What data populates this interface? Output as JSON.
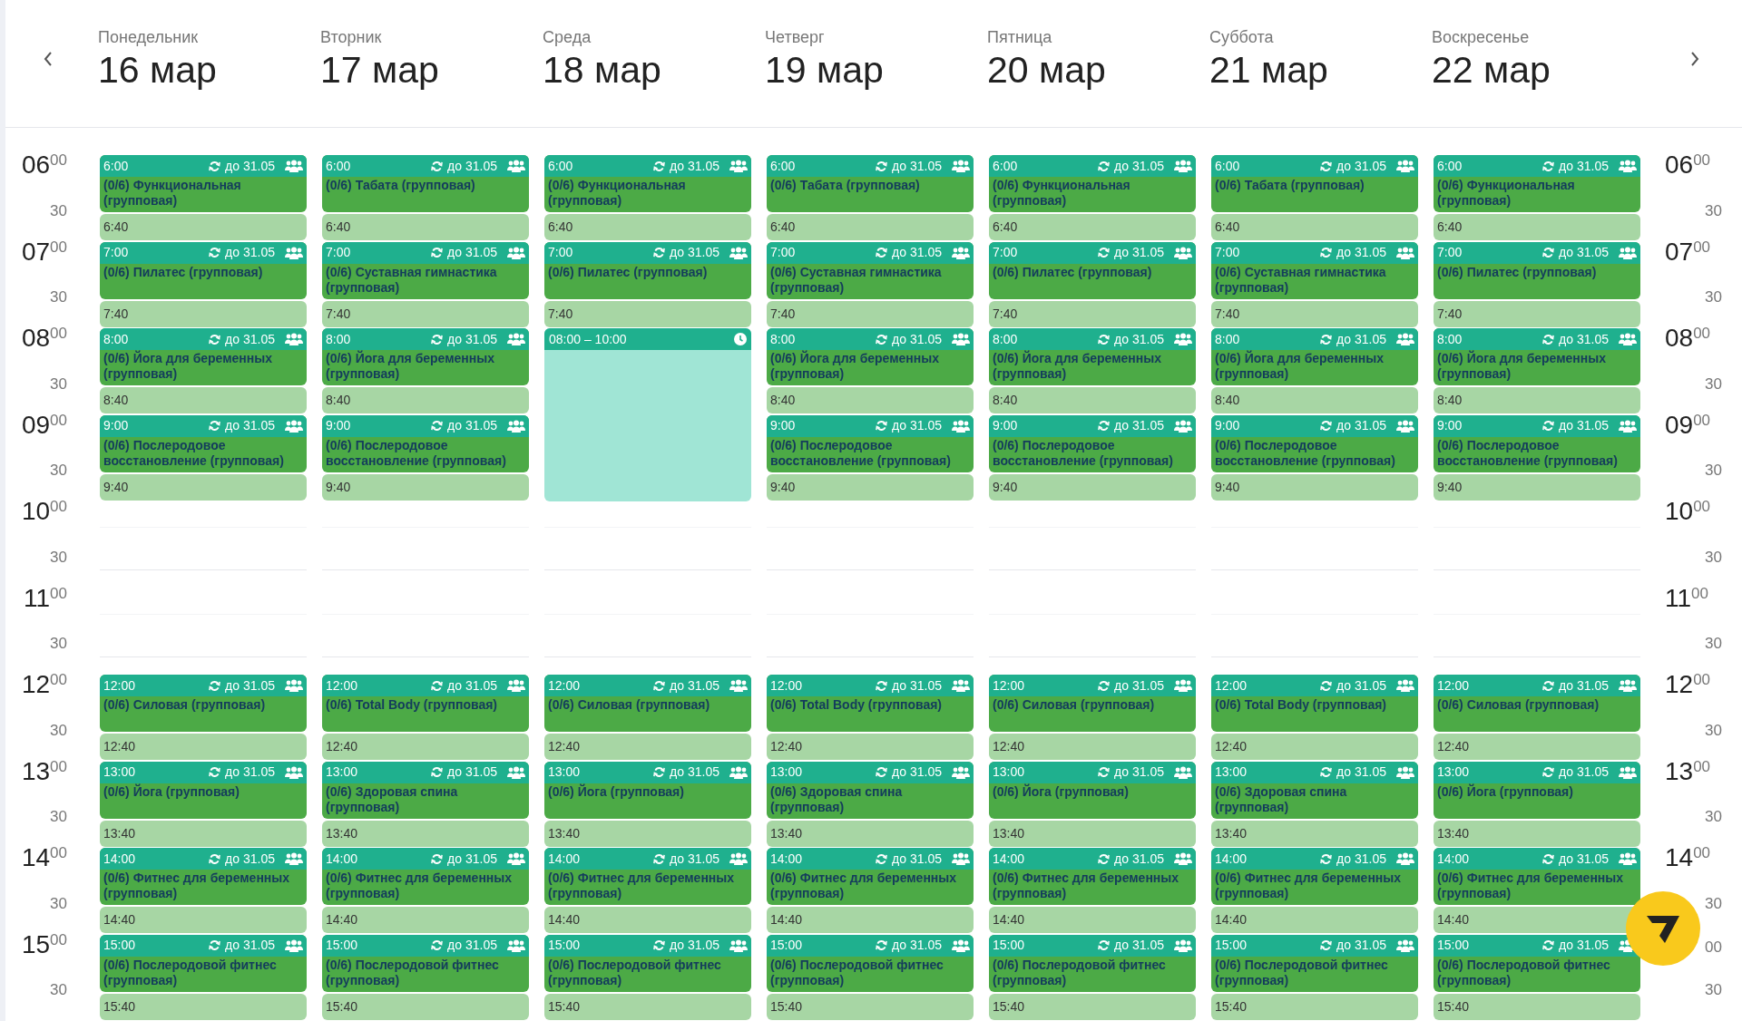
{
  "days": [
    {
      "weekday": "Понедельник",
      "date": "16 мар",
      "slots": [
        {
          "kind": "class",
          "start": "6:00",
          "repeat": "до 31.05",
          "title": "(0/6) Функциональная (групповая)",
          "end": "6:40"
        },
        {
          "kind": "class",
          "start": "7:00",
          "repeat": "до 31.05",
          "title": "(0/6) Пилатес (групповая)",
          "end": "7:40"
        },
        {
          "kind": "class",
          "start": "8:00",
          "repeat": "до 31.05",
          "title": "(0/6) Йога для беременных (групповая)",
          "end": "8:40"
        },
        {
          "kind": "class",
          "start": "9:00",
          "repeat": "до 31.05",
          "title": "(0/6) Послеродовое восстановление (групповая)",
          "end": "9:40"
        },
        {
          "kind": "free"
        },
        {
          "kind": "free"
        },
        {
          "kind": "class",
          "start": "12:00",
          "repeat": "до 31.05",
          "title": "(0/6) Силовая (групповая)",
          "end": "12:40"
        },
        {
          "kind": "class",
          "start": "13:00",
          "repeat": "до 31.05",
          "title": "(0/6) Йога (групповая)",
          "end": "13:40"
        },
        {
          "kind": "class",
          "start": "14:00",
          "repeat": "до 31.05",
          "title": "(0/6) Фитнес для беременных (групповая)",
          "end": "14:40"
        },
        {
          "kind": "class",
          "start": "15:00",
          "repeat": "до 31.05",
          "title": "(0/6) Послеродовой фитнес (групповая)",
          "end": "15:40"
        }
      ]
    },
    {
      "weekday": "Вторник",
      "date": "17 мар",
      "slots": [
        {
          "kind": "class",
          "start": "6:00",
          "repeat": "до 31.05",
          "title": "(0/6) Табата (групповая)",
          "end": "6:40"
        },
        {
          "kind": "class",
          "start": "7:00",
          "repeat": "до 31.05",
          "title": "(0/6) Суставная гимнастика (групповая)",
          "end": "7:40"
        },
        {
          "kind": "class",
          "start": "8:00",
          "repeat": "до 31.05",
          "title": "(0/6) Йога для беременных (групповая)",
          "end": "8:40"
        },
        {
          "kind": "class",
          "start": "9:00",
          "repeat": "до 31.05",
          "title": "(0/6) Послеродовое восстановление (групповая)",
          "end": "9:40"
        },
        {
          "kind": "free"
        },
        {
          "kind": "free"
        },
        {
          "kind": "class",
          "start": "12:00",
          "repeat": "до 31.05",
          "title": "(0/6) Total Body (групповая)",
          "end": "12:40"
        },
        {
          "kind": "class",
          "start": "13:00",
          "repeat": "до 31.05",
          "title": "(0/6) Здоровая спина (групповая)",
          "end": "13:40"
        },
        {
          "kind": "class",
          "start": "14:00",
          "repeat": "до 31.05",
          "title": "(0/6) Фитнес для беременных (групповая)",
          "end": "14:40"
        },
        {
          "kind": "class",
          "start": "15:00",
          "repeat": "до 31.05",
          "title": "(0/6) Послеродовой фитнес (групповая)",
          "end": "15:40"
        }
      ]
    },
    {
      "weekday": "Среда",
      "date": "18 мар",
      "slots": [
        {
          "kind": "class",
          "start": "6:00",
          "repeat": "до 31.05",
          "title": "(0/6) Функциональная (групповая)",
          "end": "6:40"
        },
        {
          "kind": "class",
          "start": "7:00",
          "repeat": "до 31.05",
          "title": "(0/6) Пилатес (групповая)",
          "end": "7:40"
        },
        {
          "kind": "booking",
          "label": "08:00 – 10:00"
        },
        {
          "kind": "free"
        },
        {
          "kind": "free"
        },
        {
          "kind": "class",
          "start": "12:00",
          "repeat": "до 31.05",
          "title": "(0/6) Силовая (групповая)",
          "end": "12:40"
        },
        {
          "kind": "class",
          "start": "13:00",
          "repeat": "до 31.05",
          "title": "(0/6) Йога (групповая)",
          "end": "13:40"
        },
        {
          "kind": "class",
          "start": "14:00",
          "repeat": "до 31.05",
          "title": "(0/6) Фитнес для беременных (групповая)",
          "end": "14:40"
        },
        {
          "kind": "class",
          "start": "15:00",
          "repeat": "до 31.05",
          "title": "(0/6) Послеродовой фитнес (групповая)",
          "end": "15:40"
        }
      ]
    },
    {
      "weekday": "Четверг",
      "date": "19 мар",
      "slots": [
        {
          "kind": "class",
          "start": "6:00",
          "repeat": "до 31.05",
          "title": "(0/6) Табата (групповая)",
          "end": "6:40"
        },
        {
          "kind": "class",
          "start": "7:00",
          "repeat": "до 31.05",
          "title": "(0/6) Суставная гимнастика (групповая)",
          "end": "7:40"
        },
        {
          "kind": "class",
          "start": "8:00",
          "repeat": "до 31.05",
          "title": "(0/6) Йога для беременных (групповая)",
          "end": "8:40"
        },
        {
          "kind": "class",
          "start": "9:00",
          "repeat": "до 31.05",
          "title": "(0/6) Послеродовое восстановление (групповая)",
          "end": "9:40"
        },
        {
          "kind": "free"
        },
        {
          "kind": "free"
        },
        {
          "kind": "class",
          "start": "12:00",
          "repeat": "до 31.05",
          "title": "(0/6) Total Body (групповая)",
          "end": "12:40"
        },
        {
          "kind": "class",
          "start": "13:00",
          "repeat": "до 31.05",
          "title": "(0/6) Здоровая спина (групповая)",
          "end": "13:40"
        },
        {
          "kind": "class",
          "start": "14:00",
          "repeat": "до 31.05",
          "title": "(0/6) Фитнес для беременных (групповая)",
          "end": "14:40"
        },
        {
          "kind": "class",
          "start": "15:00",
          "repeat": "до 31.05",
          "title": "(0/6) Послеродовой фитнес (групповая)",
          "end": "15:40"
        }
      ]
    },
    {
      "weekday": "Пятница",
      "date": "20 мар",
      "slots": [
        {
          "kind": "class",
          "start": "6:00",
          "repeat": "до 31.05",
          "title": "(0/6) Функциональная (групповая)",
          "end": "6:40"
        },
        {
          "kind": "class",
          "start": "7:00",
          "repeat": "до 31.05",
          "title": "(0/6) Пилатес (групповая)",
          "end": "7:40"
        },
        {
          "kind": "class",
          "start": "8:00",
          "repeat": "до 31.05",
          "title": "(0/6) Йога для беременных (групповая)",
          "end": "8:40"
        },
        {
          "kind": "class",
          "start": "9:00",
          "repeat": "до 31.05",
          "title": "(0/6) Послеродовое восстановление (групповая)",
          "end": "9:40"
        },
        {
          "kind": "free"
        },
        {
          "kind": "free"
        },
        {
          "kind": "class",
          "start": "12:00",
          "repeat": "до 31.05",
          "title": "(0/6) Силовая (групповая)",
          "end": "12:40"
        },
        {
          "kind": "class",
          "start": "13:00",
          "repeat": "до 31.05",
          "title": "(0/6) Йога (групповая)",
          "end": "13:40"
        },
        {
          "kind": "class",
          "start": "14:00",
          "repeat": "до 31.05",
          "title": "(0/6) Фитнес для беременных (групповая)",
          "end": "14:40"
        },
        {
          "kind": "class",
          "start": "15:00",
          "repeat": "до 31.05",
          "title": "(0/6) Послеродовой фитнес (групповая)",
          "end": "15:40"
        }
      ]
    },
    {
      "weekday": "Суббота",
      "date": "21 мар",
      "slots": [
        {
          "kind": "class",
          "start": "6:00",
          "repeat": "до 31.05",
          "title": "(0/6) Табата (групповая)",
          "end": "6:40"
        },
        {
          "kind": "class",
          "start": "7:00",
          "repeat": "до 31.05",
          "title": "(0/6) Суставная гимнастика (групповая)",
          "end": "7:40"
        },
        {
          "kind": "class",
          "start": "8:00",
          "repeat": "до 31.05",
          "title": "(0/6) Йога для беременных (групповая)",
          "end": "8:40"
        },
        {
          "kind": "class",
          "start": "9:00",
          "repeat": "до 31.05",
          "title": "(0/6) Послеродовое восстановление (групповая)",
          "end": "9:40"
        },
        {
          "kind": "free"
        },
        {
          "kind": "free"
        },
        {
          "kind": "class",
          "start": "12:00",
          "repeat": "до 31.05",
          "title": "(0/6) Total Body (групповая)",
          "end": "12:40"
        },
        {
          "kind": "class",
          "start": "13:00",
          "repeat": "до 31.05",
          "title": "(0/6) Здоровая спина (групповая)",
          "end": "13:40"
        },
        {
          "kind": "class",
          "start": "14:00",
          "repeat": "до 31.05",
          "title": "(0/6) Фитнес для беременных (групповая)",
          "end": "14:40"
        },
        {
          "kind": "class",
          "start": "15:00",
          "repeat": "до 31.05",
          "title": "(0/6) Послеродовой фитнес (групповая)",
          "end": "15:40"
        }
      ]
    },
    {
      "weekday": "Воскресенье",
      "date": "22 мар",
      "slots": [
        {
          "kind": "class",
          "start": "6:00",
          "repeat": "до 31.05",
          "title": "(0/6) Функциональная (групповая)",
          "end": "6:40"
        },
        {
          "kind": "class",
          "start": "7:00",
          "repeat": "до 31.05",
          "title": "(0/6) Пилатес (групповая)",
          "end": "7:40"
        },
        {
          "kind": "class",
          "start": "8:00",
          "repeat": "до 31.05",
          "title": "(0/6) Йога для беременных (групповая)",
          "end": "8:40"
        },
        {
          "kind": "class",
          "start": "9:00",
          "repeat": "до 31.05",
          "title": "(0/6) Послеродовое восстановление (групповая)",
          "end": "9:40"
        },
        {
          "kind": "free"
        },
        {
          "kind": "free"
        },
        {
          "kind": "class",
          "start": "12:00",
          "repeat": "до 31.05",
          "title": "(0/6) Силовая (групповая)",
          "end": "12:40"
        },
        {
          "kind": "class",
          "start": "13:00",
          "repeat": "до 31.05",
          "title": "(0/6) Йога (групповая)",
          "end": "13:40"
        },
        {
          "kind": "class",
          "start": "14:00",
          "repeat": "до 31.05",
          "title": "(0/6) Фитнес для беременных (групповая)",
          "end": "14:40"
        },
        {
          "kind": "class",
          "start": "15:00",
          "repeat": "до 31.05",
          "title": "(0/6) Послеродовой фитнес (групповая)",
          "end": "15:40"
        }
      ]
    }
  ],
  "time_axis_left": [
    {
      "hour": "06",
      "minutes": "00"
    },
    {
      "minutes": "30"
    },
    {
      "hour": "07",
      "minutes": "00"
    },
    {
      "minutes": "30"
    },
    {
      "hour": "08",
      "minutes": "00"
    },
    {
      "minutes": "30"
    },
    {
      "hour": "09",
      "minutes": "00"
    },
    {
      "minutes": "30"
    },
    {
      "hour": "10",
      "minutes": "00"
    },
    {
      "minutes": "30"
    },
    {
      "hour": "11",
      "minutes": "00"
    },
    {
      "minutes": "30"
    },
    {
      "hour": "12",
      "minutes": "00"
    },
    {
      "minutes": "30"
    },
    {
      "hour": "13",
      "minutes": "00"
    },
    {
      "minutes": "30"
    },
    {
      "hour": "14",
      "minutes": "00"
    },
    {
      "minutes": "30"
    },
    {
      "hour": "15",
      "minutes": "00"
    },
    {
      "minutes": "30"
    }
  ],
  "time_axis_right": [
    {
      "hour": "06",
      "minutes": "00"
    },
    {
      "minutes": "30"
    },
    {
      "hour": "07",
      "minutes": "00"
    },
    {
      "minutes": "30"
    },
    {
      "hour": "08",
      "minutes": "00"
    },
    {
      "minutes": "30"
    },
    {
      "hour": "09",
      "minutes": "00"
    },
    {
      "minutes": "30"
    },
    {
      "hour": "10",
      "minutes": "00"
    },
    {
      "minutes": "30"
    },
    {
      "hour": "11",
      "minutes": "00"
    },
    {
      "minutes": "30"
    },
    {
      "hour": "12",
      "minutes": "00"
    },
    {
      "minutes": "30"
    },
    {
      "hour": "13",
      "minutes": "00"
    },
    {
      "minutes": "30"
    },
    {
      "hour": "14",
      "minutes": "00"
    },
    {
      "minutes": "30"
    },
    {
      "minutes": "00"
    },
    {
      "minutes": "30"
    }
  ]
}
